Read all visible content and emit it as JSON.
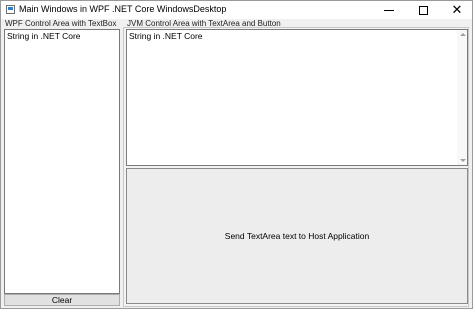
{
  "window": {
    "title": "Main Windows in WPF .NET Core WindowsDesktop",
    "icons": {
      "app": "app-window-icon",
      "minimize": "minimize-icon",
      "maximize": "maximize-icon",
      "close": "close-icon"
    },
    "close_glyph": "✕"
  },
  "left_panel": {
    "label": "WPF Control Area with TextBox",
    "textbox_value": "String in .NET Core",
    "clear_label": "Clear"
  },
  "right_panel": {
    "label": "JVM Control Area with TextArea and Button",
    "textarea_value": "String in .NET Core",
    "send_label": "Send TextArea text to Host Application"
  }
}
